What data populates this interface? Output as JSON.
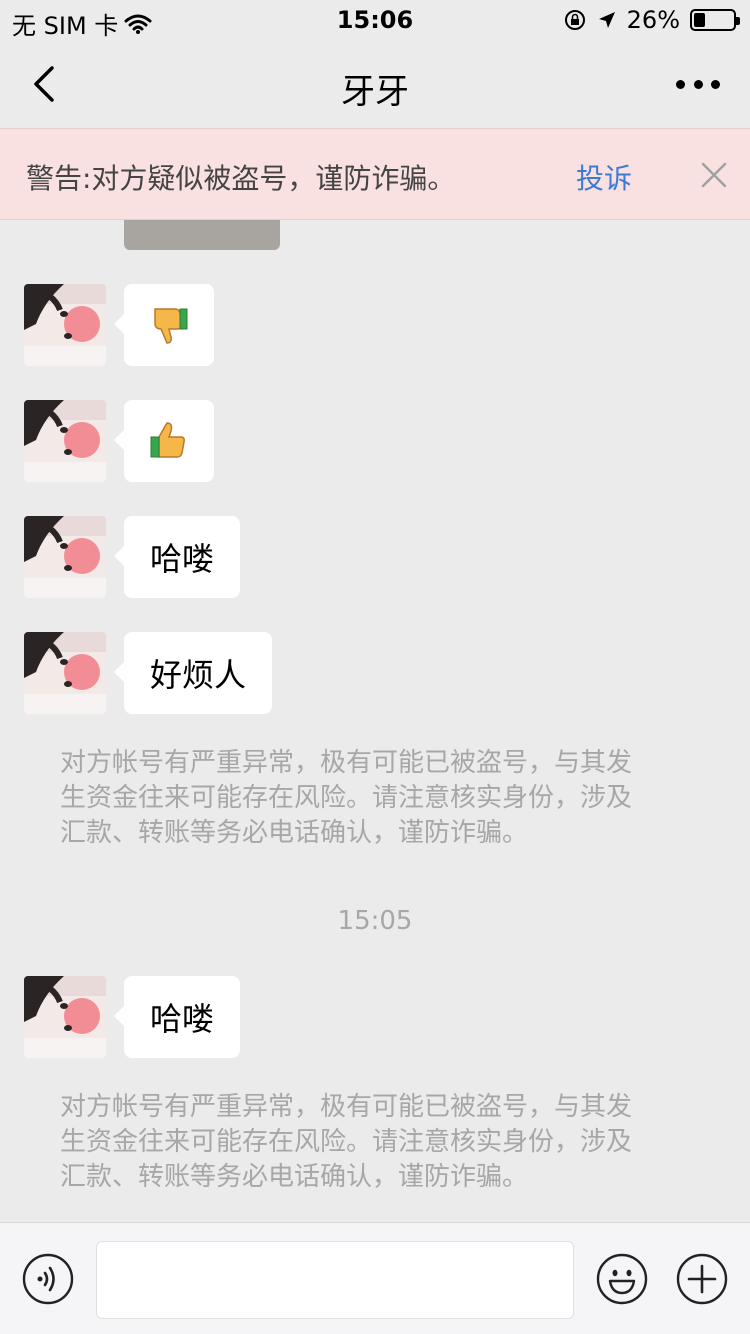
{
  "status_bar": {
    "carrier": "无 SIM 卡",
    "time": "15:06",
    "battery": "26%",
    "battery_level": 0.26,
    "icons": [
      "wifi-icon",
      "rotation-lock-icon",
      "location-arrow-icon",
      "battery-icon"
    ]
  },
  "nav": {
    "title": "牙牙",
    "icons": [
      "back-chevron-icon",
      "more-dots-icon"
    ]
  },
  "warning_banner": {
    "text": "警告:对方疑似被盗号，谨防诈骗。",
    "action_label": "投诉",
    "action_color": "#3b7bd6",
    "background_color": "#fae1e1",
    "icons": [
      "close-icon"
    ]
  },
  "messages": [
    {
      "type": "emoji",
      "icon": "thumbs-down-icon"
    },
    {
      "type": "emoji",
      "icon": "thumbs-up-icon"
    },
    {
      "type": "text",
      "text": "哈喽"
    },
    {
      "type": "text",
      "text": "好烦人"
    }
  ],
  "system_warning_1": {
    "line1": "对方帐号有严重异常，极有可能已被盗号，与其发",
    "line2": "生资金往来可能存在风险。请注意核实身份，涉及",
    "line3": "汇款、转账等务必电话确认，谨防诈骗。"
  },
  "time_divider": "15:05",
  "message_after": {
    "type": "text",
    "text": "哈喽"
  },
  "system_warning_2": {
    "line1": "对方帐号有严重异常，极有可能已被盗号，与其发",
    "line2": "生资金往来可能存在风险。请注意核实身份，涉及",
    "line3": "汇款、转账等务必电话确认，谨防诈骗。"
  },
  "input_bar": {
    "icons": [
      "voice-icon",
      "emoji-face-icon",
      "plus-icon"
    ],
    "text_value": ""
  }
}
